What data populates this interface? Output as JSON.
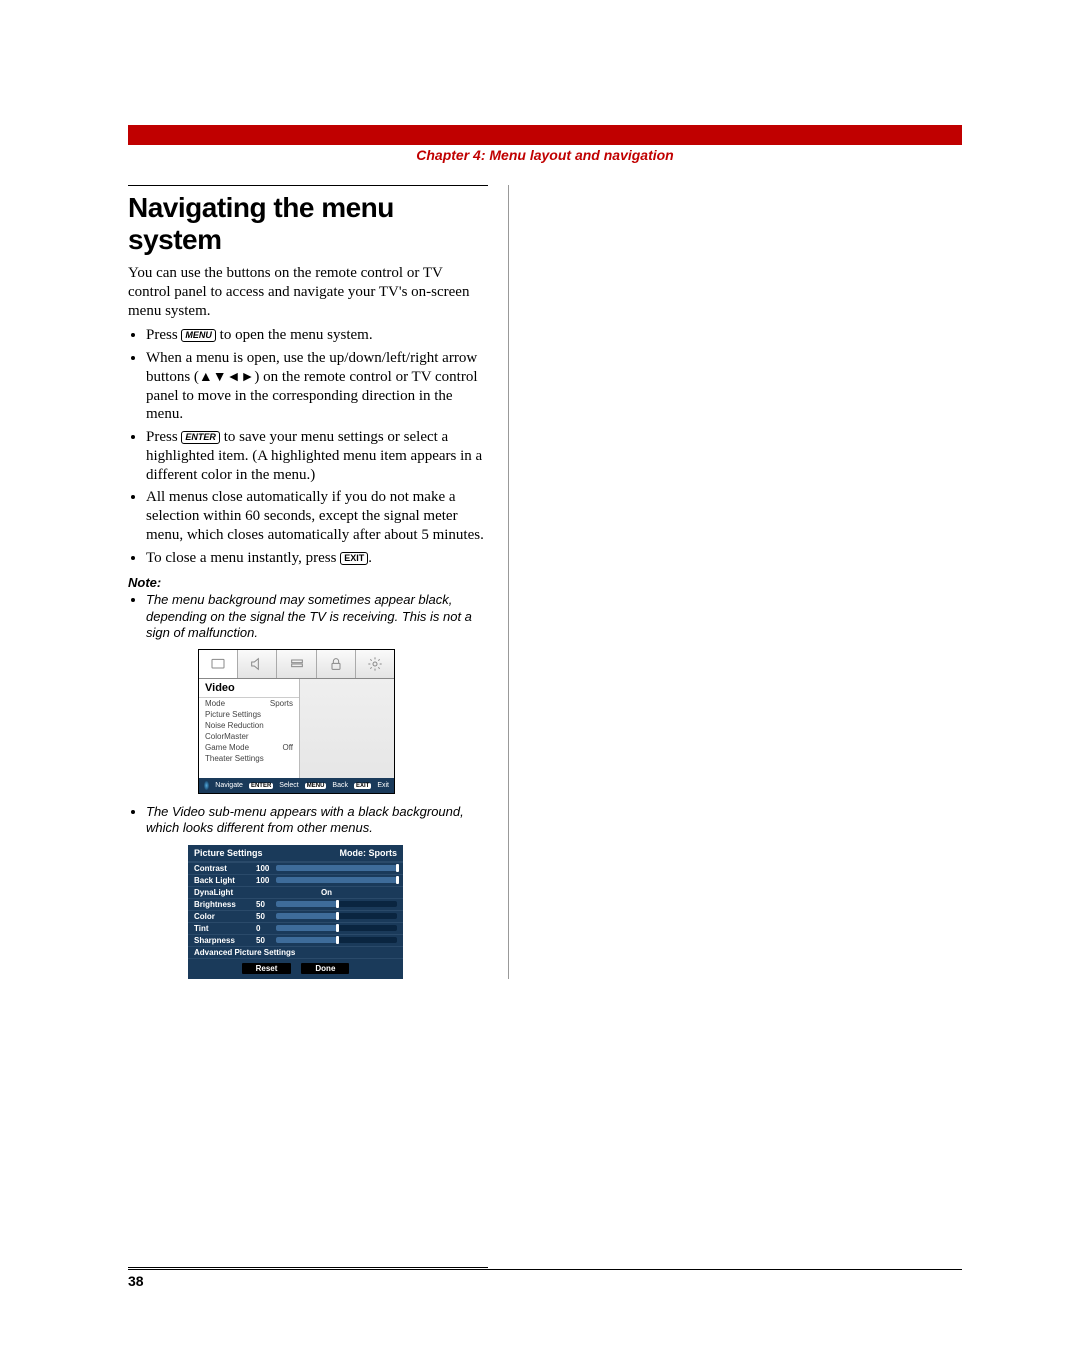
{
  "chapter": "Chapter 4: Menu layout and navigation",
  "heading": "Navigating the menu system",
  "intro": "You can use the buttons on the remote control or TV control panel to access and navigate your TV's on-screen menu system.",
  "bullets": {
    "b1a": "Press ",
    "b1b": " to open the menu system.",
    "b2a": "When a menu is open, use the up/down/left/right arrow buttons (",
    "b2b": ") on the remote control or TV control panel to move in the corresponding direction in the menu.",
    "b3a": "Press ",
    "b3b": " to save your menu settings or select a highlighted item. (A highlighted menu item appears in a different color in the menu.)",
    "b4": "All menus close automatically if you do not make a selection within 60 seconds, except the signal meter menu, which closes automatically after about 5 minutes.",
    "b5a": "To close a menu instantly, press ",
    "b5b": "."
  },
  "keys": {
    "menu": "MENU",
    "enter": "ENTER",
    "exit": "EXIT"
  },
  "arrows": "▲▼◄►",
  "note_head": "Note:",
  "notes": {
    "n1": "The menu background may sometimes appear black, depending on the signal the TV is receiving. This is not a sign of malfunction.",
    "n2": "The Video sub-menu appears with a black background, which looks different from other menus."
  },
  "menu1": {
    "title": "Video",
    "rows": [
      {
        "l": "Mode",
        "r": "Sports"
      },
      {
        "l": "Picture Settings",
        "r": ""
      },
      {
        "l": "Noise Reduction",
        "r": ""
      },
      {
        "l": "ColorMaster",
        "r": ""
      },
      {
        "l": "Game Mode",
        "r": "Off"
      },
      {
        "l": "Theater Settings",
        "r": ""
      }
    ],
    "footer": {
      "navigate": "Navigate",
      "k_enter": "ENTER",
      "select": "Select",
      "k_menu": "MENU",
      "back": "Back",
      "k_exit": "EXIT",
      "exit": "Exit"
    }
  },
  "menu2": {
    "title": "Picture Settings",
    "mode_label": "Mode: Sports",
    "rows": [
      {
        "label": "Contrast",
        "value": "100",
        "pct": 100
      },
      {
        "label": "Back Light",
        "value": "100",
        "pct": 100
      },
      {
        "label": "DynaLight",
        "value": "On",
        "type": "on"
      },
      {
        "label": "Brightness",
        "value": "50",
        "pct": 50
      },
      {
        "label": "Color",
        "value": "50",
        "pct": 50
      },
      {
        "label": "Tint",
        "value": "0",
        "pct": 50
      },
      {
        "label": "Sharpness",
        "value": "50",
        "pct": 50
      },
      {
        "label": "Advanced Picture Settings",
        "type": "full"
      }
    ],
    "reset": "Reset",
    "done": "Done"
  },
  "page_number": "38"
}
